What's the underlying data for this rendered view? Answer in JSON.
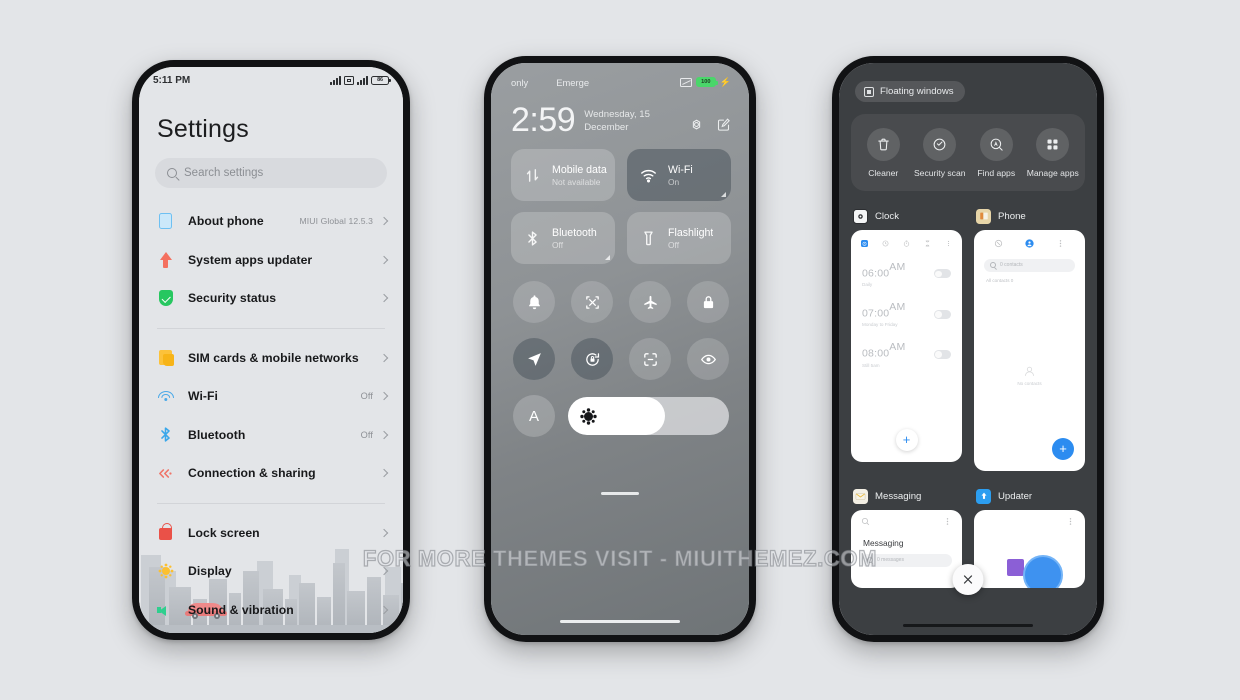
{
  "watermark": {
    "text": "FOR MORE THEMES VISIT - MIUITHEMEZ.COM"
  },
  "phone1": {
    "status": {
      "time": "5:11 PM",
      "battery": "86"
    },
    "title": "Settings",
    "search": {
      "placeholder": "Search settings",
      "icon": "search-icon"
    },
    "groups": [
      {
        "items": [
          {
            "label": "About phone",
            "value": "MIUI Global 12.5.3",
            "icon": "about-phone-icon"
          },
          {
            "label": "System apps updater",
            "value": "",
            "icon": "system-updater-icon"
          },
          {
            "label": "Security status",
            "value": "",
            "icon": "security-shield-icon"
          }
        ]
      },
      {
        "items": [
          {
            "label": "SIM cards & mobile networks",
            "value": "",
            "icon": "sim-card-icon"
          },
          {
            "label": "Wi-Fi",
            "value": "Off",
            "icon": "wifi-icon"
          },
          {
            "label": "Bluetooth",
            "value": "Off",
            "icon": "bluetooth-icon"
          },
          {
            "label": "Connection & sharing",
            "value": "",
            "icon": "connection-sharing-icon"
          }
        ]
      },
      {
        "items": [
          {
            "label": "Lock screen",
            "value": "",
            "icon": "lock-screen-icon"
          },
          {
            "label": "Display",
            "value": "",
            "icon": "display-brightness-icon"
          },
          {
            "label": "Sound & vibration",
            "value": "",
            "icon": "sound-vibration-icon"
          }
        ]
      }
    ]
  },
  "phone2": {
    "status": {
      "carrier_left": "only",
      "carrier_right": "Emerge",
      "battery": "100"
    },
    "clock": {
      "time": "2:59",
      "date": "Wednesday, 15 December"
    },
    "actions": [
      {
        "name": "settings-gear-icon"
      },
      {
        "name": "edit-icon"
      }
    ],
    "big_tiles": [
      {
        "title": "Mobile data",
        "sub": "Not available",
        "icon": "mobile-data-icon",
        "on": false,
        "corner": false
      },
      {
        "title": "Wi-Fi",
        "sub": "On",
        "icon": "wifi-icon",
        "on": true,
        "corner": true
      },
      {
        "title": "Bluetooth",
        "sub": "Off",
        "icon": "bluetooth-icon",
        "on": false,
        "corner": true
      },
      {
        "title": "Flashlight",
        "sub": "Off",
        "icon": "flashlight-icon",
        "on": false,
        "corner": false
      }
    ],
    "circle_tiles": [
      {
        "icon": "bell-silent-icon",
        "on": false
      },
      {
        "icon": "screenshot-icon",
        "on": false
      },
      {
        "icon": "airplane-mode-icon",
        "on": false
      },
      {
        "icon": "lock-icon",
        "on": false
      },
      {
        "icon": "location-icon",
        "on": true
      },
      {
        "icon": "auto-rotate-icon",
        "on": true
      },
      {
        "icon": "scan-icon",
        "on": false
      },
      {
        "icon": "reading-mode-eye-icon",
        "on": false
      }
    ],
    "brightness": {
      "auto_label": "A",
      "level_percent": 60,
      "icon": "brightness-sun-icon"
    }
  },
  "phone3": {
    "floating_windows": {
      "label": "Floating windows",
      "icon": "floating-window-icon"
    },
    "tools": [
      {
        "label": "Cleaner",
        "icon": "trash-icon"
      },
      {
        "label": "Security scan",
        "icon": "security-scan-icon"
      },
      {
        "label": "Find apps",
        "icon": "find-apps-icon"
      },
      {
        "label": "Manage apps",
        "icon": "manage-apps-icon"
      }
    ],
    "apps": [
      {
        "name": "Clock",
        "icon": "clock-app-icon"
      },
      {
        "name": "Phone",
        "icon": "phone-app-icon"
      },
      {
        "name": "Messaging",
        "icon": "messaging-app-icon"
      },
      {
        "name": "Updater",
        "icon": "updater-app-icon"
      }
    ],
    "clock_card": {
      "tabs": [
        "alarm-tab",
        "world-clock-tab",
        "stopwatch-tab",
        "timer-tab",
        "overflow-menu"
      ],
      "alarms": [
        {
          "time": "06:00",
          "meridiem": "AM",
          "sub": "Daily",
          "enabled": false
        },
        {
          "time": "07:00",
          "meridiem": "AM",
          "sub": "Monday to Friday",
          "enabled": false
        },
        {
          "time": "08:00",
          "meridiem": "AM",
          "sub": "Still 5am",
          "enabled": false
        }
      ],
      "add_label": "+"
    },
    "phone_card": {
      "search_placeholder": "0 contacts",
      "subtitle": "All contacts  0",
      "empty_label": "No contacts",
      "add_label": "+"
    },
    "messaging_card": {
      "title": "Messaging",
      "search_placeholder": "0 messages"
    },
    "close_button": {
      "icon": "close-icon"
    }
  },
  "colors": {
    "background": "#e3e5e8",
    "accent_blue": "#2c8cf0",
    "frame": "#111214",
    "recents_bg": "#3c3f42"
  }
}
